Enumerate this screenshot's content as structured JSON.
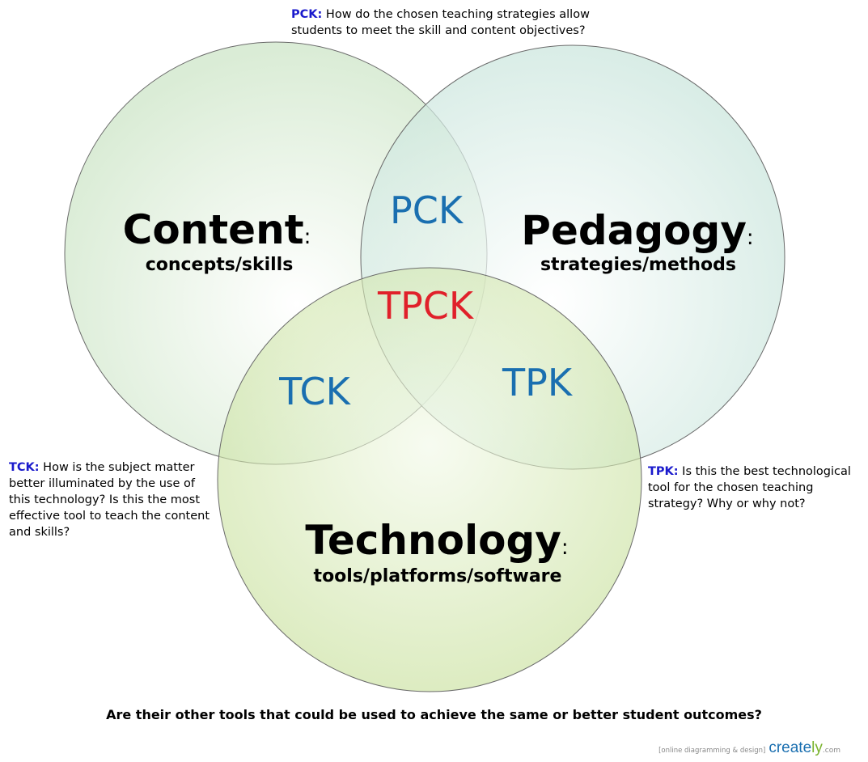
{
  "circles": {
    "content": {
      "title": "Content",
      "colon": ":",
      "subtitle": "concepts/skills"
    },
    "pedagogy": {
      "title": "Pedagogy",
      "colon": ":",
      "subtitle": "strategies/methods"
    },
    "technology": {
      "title": "Technology",
      "colon": ":",
      "subtitle": "tools/platforms/software"
    }
  },
  "overlaps": {
    "pck": "PCK",
    "tck": "TCK",
    "tpk": "TPK",
    "tpck": "TPCK"
  },
  "notes": {
    "pck": {
      "tag": "PCK:",
      "text": " How do the chosen teaching strategies allow students to meet the skill and content objectives?"
    },
    "tck": {
      "tag": "TCK:",
      "text": " How is the subject matter better illuminated by the use of this technology? Is this the most effective tool to teach the content and skills?"
    },
    "tpk": {
      "tag": "TPK:",
      "text": " Is this the best technological tool for the chosen teaching strategy? Why or why not?"
    }
  },
  "footer": {
    "question": "Are their other tools that could be used to achieve the same or better student outcomes?"
  },
  "watermark": {
    "prefix": "[online diagramming & design]",
    "brand_a": "creat",
    "brand_b": "e",
    "brand_c": "ly",
    "domain": ".com"
  },
  "colors": {
    "overlap_label": "#1a6fb0",
    "center_label": "#e0202a",
    "note_tag": "#1a1acc",
    "content_fill": "#d9ecd6",
    "pedagogy_fill": "#cfe8df",
    "technology_fill": "#cfe3a6"
  }
}
